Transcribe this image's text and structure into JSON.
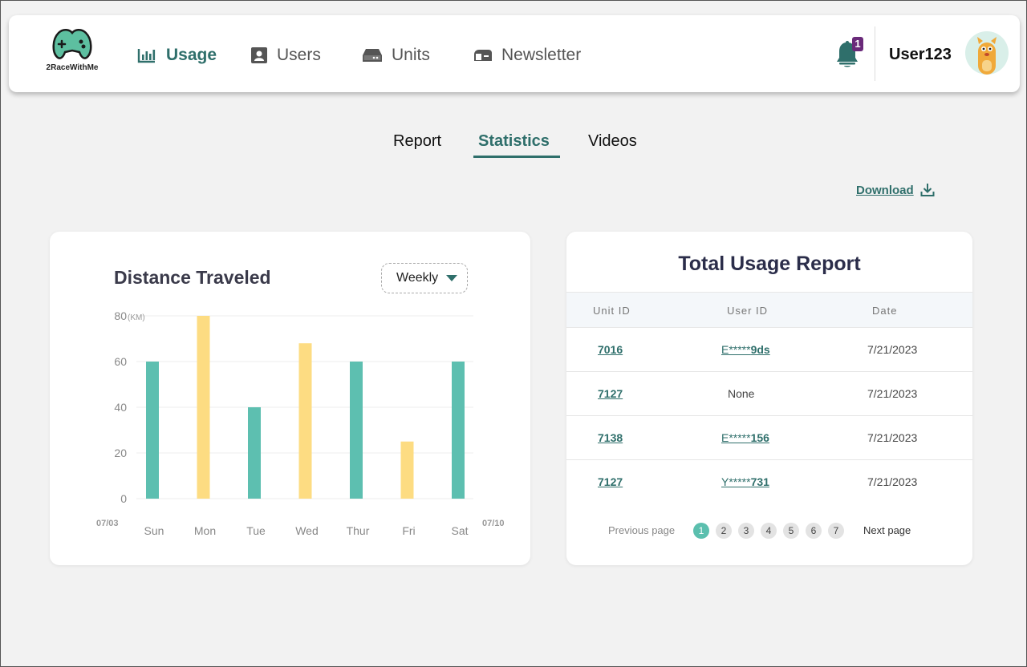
{
  "brand": {
    "name": "2RaceWithMe"
  },
  "nav": [
    {
      "label": "Usage",
      "icon": "bar-chart-icon",
      "active": true
    },
    {
      "label": "Users",
      "icon": "user-card-icon",
      "active": false
    },
    {
      "label": "Units",
      "icon": "drive-icon",
      "active": false
    },
    {
      "label": "Newsletter",
      "icon": "mailbox-icon",
      "active": false
    }
  ],
  "header": {
    "notification_count": "1",
    "username": "User123"
  },
  "tabs": [
    {
      "label": "Report",
      "active": false
    },
    {
      "label": "Statistics",
      "active": true
    },
    {
      "label": "Videos",
      "active": false
    }
  ],
  "download": {
    "label": "Download"
  },
  "distance": {
    "title": "Distance Traveled",
    "period_select": "Weekly",
    "date_start": "07/03",
    "date_end": "07/10"
  },
  "chart_data": {
    "type": "bar",
    "title": "Distance Traveled",
    "categories": [
      "Sun",
      "Mon",
      "Tue",
      "Wed",
      "Thur",
      "Fri",
      "Sat"
    ],
    "values": [
      60,
      80,
      40,
      68,
      60,
      25,
      60
    ],
    "bar_colors": [
      "#5dbfb0",
      "#fddc82",
      "#5dbfb0",
      "#fddc82",
      "#5dbfb0",
      "#fddc82",
      "#5dbfb0"
    ],
    "yticks": [
      "80",
      "60",
      "40",
      "20",
      "0"
    ],
    "yunit": "(KM)",
    "ylim": [
      0,
      80
    ],
    "grid": true
  },
  "report": {
    "title": "Total Usage Report",
    "columns": [
      "Unit ID",
      "User ID",
      "Date"
    ],
    "rows": [
      {
        "unit": "7016",
        "user_prefix": "E*****",
        "user_suffix": "9ds",
        "date": "7/21/2023"
      },
      {
        "unit": "7127",
        "user_prefix": "",
        "user_suffix": "None",
        "date": "7/21/2023"
      },
      {
        "unit": "7138",
        "user_prefix": "E*****",
        "user_suffix": "156",
        "date": "7/21/2023"
      },
      {
        "unit": "7127",
        "user_prefix": "Y*****",
        "user_suffix": "731",
        "date": "7/21/2023"
      }
    ],
    "pagination": {
      "prev_label": "Previous page",
      "next_label": "Next page",
      "pages": [
        "1",
        "2",
        "3",
        "4",
        "5",
        "6",
        "7"
      ],
      "current": "1"
    }
  },
  "colors": {
    "accent": "#2f6f6b",
    "teal_bar": "#5dbfb0",
    "yellow_bar": "#fddc82",
    "badge": "#6a2a7a"
  }
}
